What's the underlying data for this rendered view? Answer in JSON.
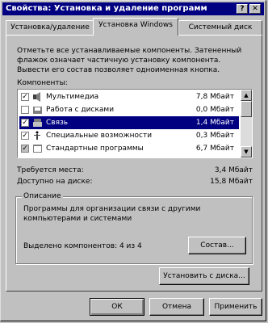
{
  "window": {
    "title": "Свойства: Установка и удаление программ",
    "help_btn": "?",
    "close_btn": "✕"
  },
  "tabs": [
    {
      "label": "Установка/удаление"
    },
    {
      "label": "Установка Windows"
    },
    {
      "label": "Системный диск"
    }
  ],
  "description": "Отметьте все устанавливаемые компоненты. Затененный флажок означает частичную установку компонента. Вывести его состав позволяет одноименная кнопка.",
  "components_label": "Компоненты:",
  "components": [
    {
      "name": "Мультимедиа",
      "size": "7,8 Мбайт",
      "checked": true,
      "icon": "speaker-icon"
    },
    {
      "name": "Работа с дисками",
      "size": "0,0 Мбайт",
      "checked": false,
      "icon": "disk-tools-icon"
    },
    {
      "name": "Связь",
      "size": "1,4 Мбайт",
      "checked": true,
      "icon": "phone-icon"
    },
    {
      "name": "Специальные возможности",
      "size": "0,3 Мбайт",
      "checked": true,
      "icon": "accessibility-icon"
    },
    {
      "name": "Стандартные программы",
      "size": "6,7 Мбайт",
      "checked": true,
      "icon": "accessories-icon"
    }
  ],
  "required_label": "Требуется места:",
  "required_value": "3,4 Мбайт",
  "available_label": "Доступно на диске:",
  "available_value": "15,8 Мбайт",
  "group": {
    "title": "Описание",
    "text": "Программы для организации связи с другими компьютерами и системами",
    "selected_label": "Выделено компонентов: 4 из 4",
    "details_button": "Состав..."
  },
  "install_disk_button": "Установить с диска...",
  "buttons": {
    "ok": "ОК",
    "cancel": "Отмена",
    "apply": "Применить"
  }
}
